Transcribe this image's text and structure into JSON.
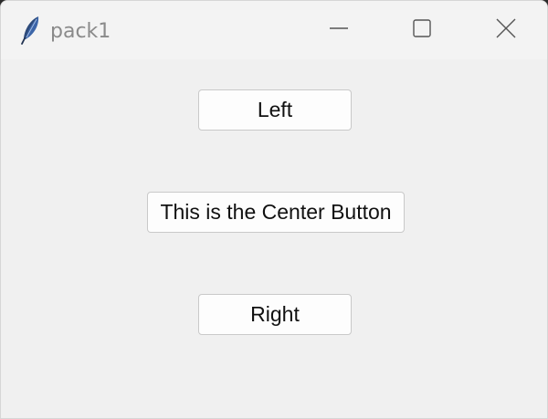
{
  "window": {
    "title": "pack1",
    "app_icon": "feather-icon",
    "controls": {
      "minimize_icon": "minimize-icon",
      "maximize_icon": "maximize-icon",
      "close_icon": "close-icon"
    }
  },
  "buttons": {
    "left_label": "Left",
    "center_label": "This is the Center Button",
    "right_label": "Right"
  },
  "colors": {
    "window_background": "#f0f0f0",
    "button_background": "#fdfdfd",
    "button_border": "#c9c9c9",
    "title_text": "#8a8a8a"
  }
}
